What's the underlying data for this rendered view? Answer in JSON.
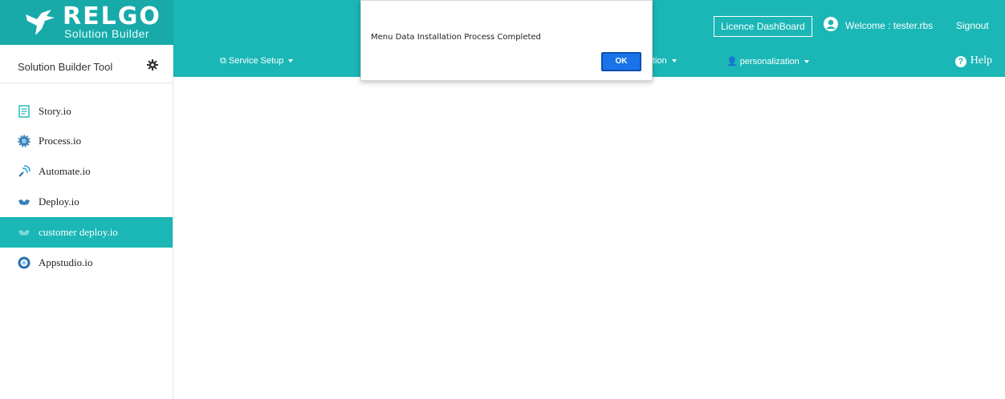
{
  "brand": {
    "title": "RELGO",
    "subtitle": "Solution Builder"
  },
  "header": {
    "licence_label": "Licence DashBoard",
    "welcome_text": "Welcome : tester.rbs",
    "signout_label": "Signout"
  },
  "tool": {
    "title": "Solution Builder Tool"
  },
  "nav": {
    "service_setup": "Service Setup",
    "partial_item": "tion",
    "personalization": "personalization",
    "help": "Help"
  },
  "sidebar": {
    "items": [
      {
        "label": "Story.io"
      },
      {
        "label": "Process.io"
      },
      {
        "label": "Automate.io"
      },
      {
        "label": "Deploy.io"
      },
      {
        "label": "customer deploy.io",
        "active": true
      },
      {
        "label": "Appstudio.io"
      }
    ]
  },
  "dialog": {
    "message": "Menu Data Installation Process Completed",
    "ok_label": "OK"
  },
  "colors": {
    "primary": "#1bb6b6",
    "logo_bg": "#18a9a9",
    "ok_button": "#1a73e8"
  }
}
